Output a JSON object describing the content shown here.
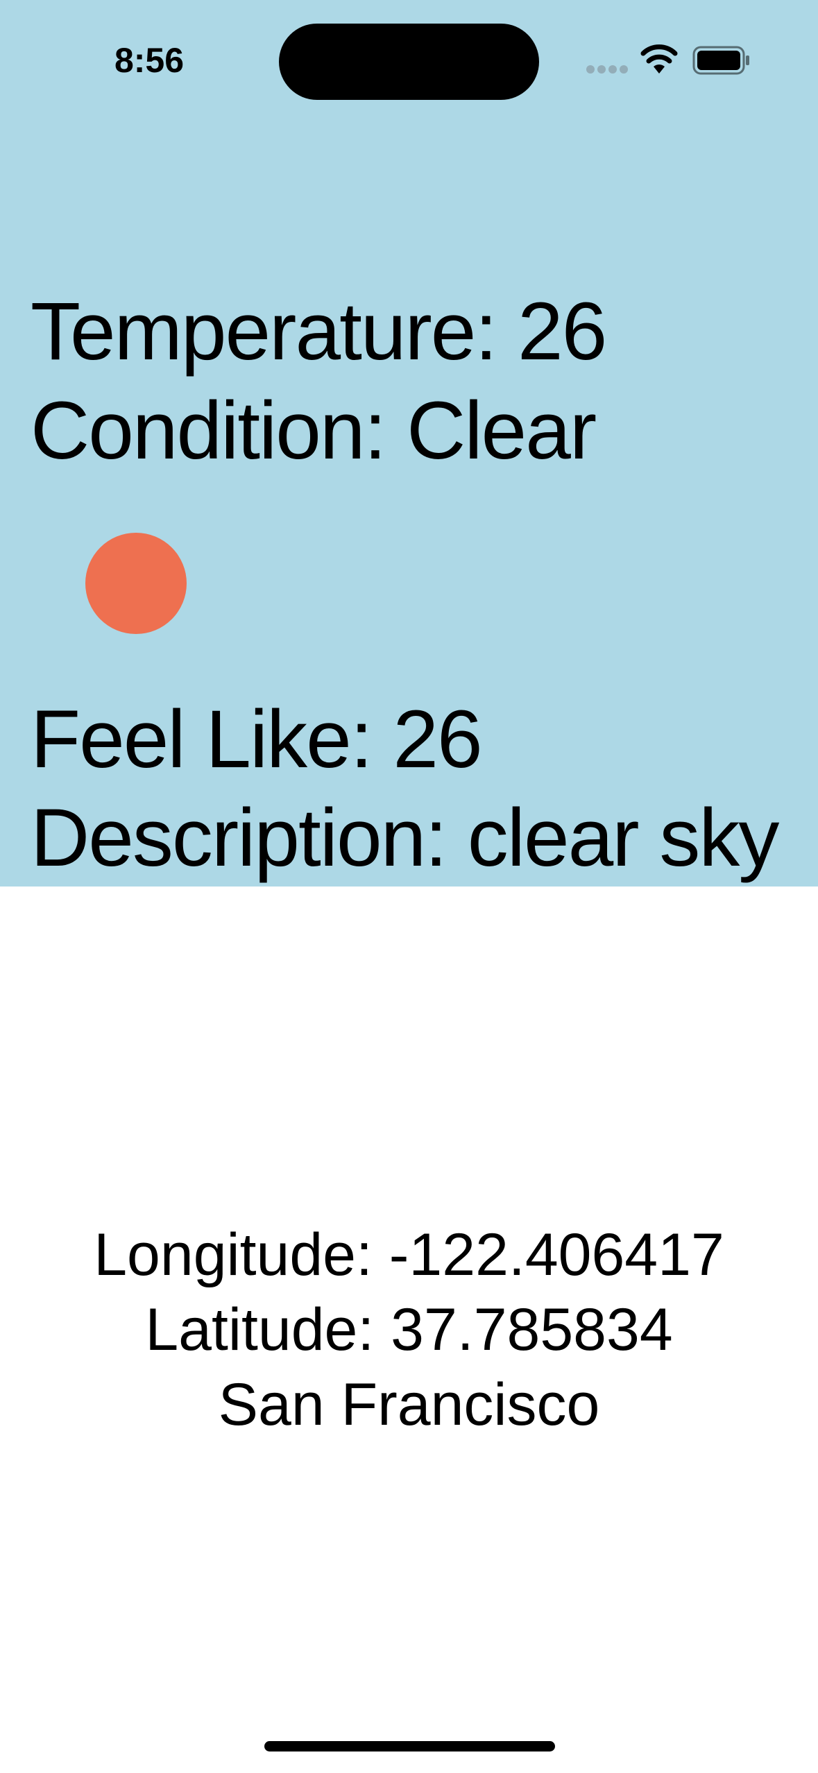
{
  "status_bar": {
    "time": "8:56",
    "icons": [
      "signal-dots-icon",
      "wifi-icon",
      "battery-icon"
    ]
  },
  "weather": {
    "temperature_text": "Temperature: 26",
    "condition_text": "Condition: Clear",
    "feels_like_text": "Feel Like: 26",
    "description_text": "Description: clear sky",
    "condition_indicator_color": "#EE7050"
  },
  "location": {
    "longitude_text": "Longitude: -122.406417",
    "latitude_text": "Latitude: 37.785834",
    "city": "San Francisco"
  },
  "colors": {
    "weather_background": "#ADD8E6",
    "page_background": "#FFFFFF",
    "text": "#000000"
  }
}
